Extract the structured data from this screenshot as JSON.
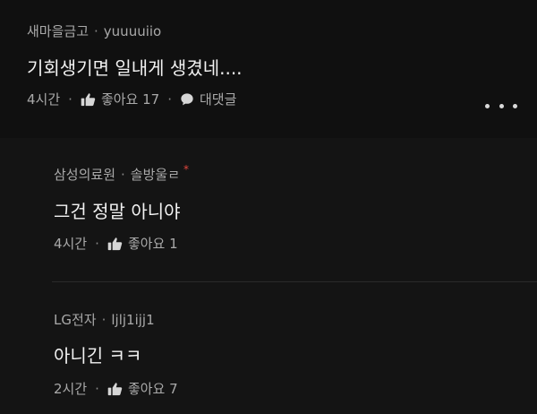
{
  "comments": [
    {
      "author": "새마을금고",
      "username": "yuuuuiio",
      "text": "기회생기면 일내게 생겼네....",
      "time": "4시간",
      "likes_label": "좋아요 17",
      "reply_label": "대댓글",
      "icons": [
        "thumbs-up-icon",
        "chat-bubble-icon",
        "more-options-icon"
      ]
    },
    {
      "author": "삼성의료원",
      "username": "솔방울ㄹ",
      "verified_mark": "*",
      "text": "그건 정말 아니야",
      "time": "4시간",
      "likes_label": "좋아요 1"
    },
    {
      "author": "LG전자",
      "username": "ljlj1ijj1",
      "text": "아니긴 ㅋㅋ",
      "time": "2시간",
      "likes_label": "좋아요 7"
    }
  ],
  "separator": "·",
  "colors": {
    "background": "#101010",
    "reply_background": "#141414",
    "meta_text": "#a9a9a9",
    "body_text": "#f2f2f2",
    "verified": "#e0463e"
  }
}
